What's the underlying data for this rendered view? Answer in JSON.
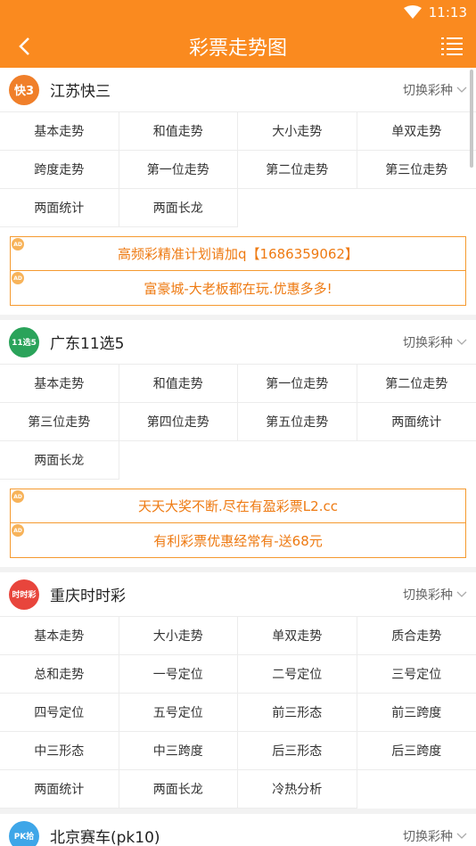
{
  "status": {
    "time": "11:13"
  },
  "header": {
    "title": "彩票走势图"
  },
  "sections": [
    {
      "name": "江苏快三",
      "logo_text": "快3",
      "logo_color": "#f07f2a",
      "switch_label": "切换彩种",
      "items": [
        "基本走势",
        "和值走势",
        "大小走势",
        "单双走势",
        "跨度走势",
        "第一位走势",
        "第二位走势",
        "第三位走势",
        "两面统计",
        "两面长龙"
      ],
      "ads": [
        "高频彩精准计划请加q【1686359062】",
        "富豪城-大老板都在玩.优惠多多!"
      ]
    },
    {
      "name": "广东11选5",
      "logo_text": "11选5",
      "logo_color": "#2aa35a",
      "switch_label": "切换彩种",
      "items": [
        "基本走势",
        "和值走势",
        "第一位走势",
        "第二位走势",
        "第三位走势",
        "第四位走势",
        "第五位走势",
        "两面统计",
        "两面长龙"
      ],
      "ads": [
        "天天大奖不断.尽在有盈彩票L2.cc",
        "有利彩票优惠经常有-送68元"
      ]
    },
    {
      "name": "重庆时时彩",
      "logo_text": "时时彩",
      "logo_color": "#e8453c",
      "switch_label": "切换彩种",
      "items": [
        "基本走势",
        "大小走势",
        "单双走势",
        "质合走势",
        "总和走势",
        "一号定位",
        "二号定位",
        "三号定位",
        "四号定位",
        "五号定位",
        "前三形态",
        "前三跨度",
        "中三形态",
        "中三跨度",
        "后三形态",
        "后三跨度",
        "两面统计",
        "两面长龙",
        "冷热分析"
      ],
      "ads": []
    },
    {
      "name": "北京赛车(pk10)",
      "logo_text": "PK拾",
      "logo_color": "#3ea6e8",
      "switch_label": "切换彩种",
      "items": [],
      "ads": []
    }
  ],
  "ad_badge": "AD"
}
